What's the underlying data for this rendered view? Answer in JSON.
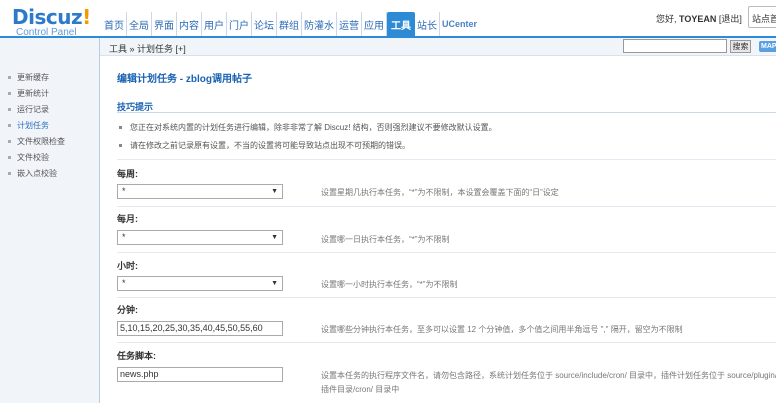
{
  "logo": {
    "main": "Discuz",
    "mark": "!",
    "sub": "Control Panel"
  },
  "nav": [
    {
      "label": "首页",
      "active": false
    },
    {
      "label": "全局",
      "active": false
    },
    {
      "label": "界面",
      "active": false
    },
    {
      "label": "内容",
      "active": false
    },
    {
      "label": "用户",
      "active": false
    },
    {
      "label": "门户",
      "active": false
    },
    {
      "label": "论坛",
      "active": false
    },
    {
      "label": "群组",
      "active": false
    },
    {
      "label": "防灌水",
      "active": false
    },
    {
      "label": "运营",
      "active": false
    },
    {
      "label": "应用",
      "active": false
    },
    {
      "label": "工具",
      "active": true
    },
    {
      "label": "站长",
      "active": false
    },
    {
      "label": "UCenter",
      "active": false
    }
  ],
  "user": {
    "greeting": "您好,",
    "name": "TOYEAN",
    "logout": "[退出]",
    "site_button": "站点首"
  },
  "subbar": {
    "breadcrumb": "工具 » 计划任务 [+]",
    "search_button": "搜索",
    "map_button": "MAP"
  },
  "sidebar": {
    "items": [
      {
        "label": "更新缓存",
        "active": false
      },
      {
        "label": "更新统计",
        "active": false
      },
      {
        "label": "运行记录",
        "active": false
      },
      {
        "label": "计划任务",
        "active": true
      },
      {
        "label": "文件权限检查",
        "active": false
      },
      {
        "label": "文件校验",
        "active": false
      },
      {
        "label": "嵌入点校验",
        "active": false
      }
    ]
  },
  "main": {
    "title": "编辑计划任务 - zblog调用帖子",
    "tips_title": "技巧提示",
    "tips": [
      "您正在对系统内置的计划任务进行编辑，除非非常了解 Discuz! 结构，否则强烈建议不要修改默认设置。",
      "请在修改之前记录原有设置，不当的设置将可能导致站点出现不可预期的错误。"
    ],
    "fields": [
      {
        "label": "每周:",
        "type": "select",
        "value": "*",
        "desc": "设置星期几执行本任务，“*”为不限制，本设置会覆盖下面的“日”设定"
      },
      {
        "label": "每月:",
        "type": "select",
        "value": "*",
        "desc": "设置哪一日执行本任务，“*”为不限制"
      },
      {
        "label": "小时:",
        "type": "select",
        "value": "*",
        "desc": "设置哪一小时执行本任务，“*”为不限制"
      },
      {
        "label": "分钟:",
        "type": "text",
        "value": "5,10,15,20,25,30,35,40,45,50,55,60",
        "desc": "设置哪些分钟执行本任务，至多可以设置 12 个分钟值，多个值之间用半角逗号 \",\" 隔开，留空为不限制"
      },
      {
        "label": "任务脚本:",
        "type": "text",
        "value": "news.php",
        "desc": "设置本任务的执行程序文件名，请勿包含路径，系统计划任务位于 source/include/cron/ 目录中，插件计划任务位于 source/plugin/",
        "desc2": "插件目录/cron/ 目录中"
      }
    ]
  },
  "colors": {
    "accent": "#2d8ad4",
    "link": "#1a63b3"
  }
}
